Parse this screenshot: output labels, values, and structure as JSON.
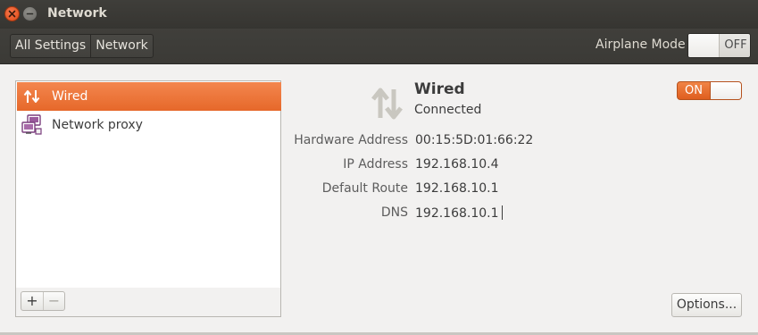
{
  "window": {
    "title": "Network",
    "close_icon": "close-icon",
    "minimize_icon": "minimize-icon"
  },
  "toolbar": {
    "breadcrumbs": [
      "All Settings",
      "Network"
    ],
    "airplane_mode_label": "Airplane Mode",
    "airplane_mode_state": "OFF"
  },
  "devices": [
    {
      "label": "Wired",
      "icon": "wired-arrows-icon",
      "selected": true
    },
    {
      "label": "Network proxy",
      "icon": "network-proxy-icon",
      "selected": false
    }
  ],
  "list_buttons": {
    "add": "+",
    "remove": "−"
  },
  "detail": {
    "name": "Wired",
    "status": "Connected",
    "power_state": "ON",
    "rows": [
      {
        "label": "Hardware Address",
        "value": "00:15:5D:01:66:22"
      },
      {
        "label": "IP Address",
        "value": "192.168.10.4"
      },
      {
        "label": "Default Route",
        "value": "192.168.10.1"
      },
      {
        "label": "DNS",
        "value": "192.168.10.1"
      }
    ],
    "options_label": "Options..."
  },
  "colors": {
    "accent": "#e95420",
    "selected_row": "#ee7a3f",
    "titlebar": "#3c3b37",
    "content_bg": "#f2f1f0"
  }
}
